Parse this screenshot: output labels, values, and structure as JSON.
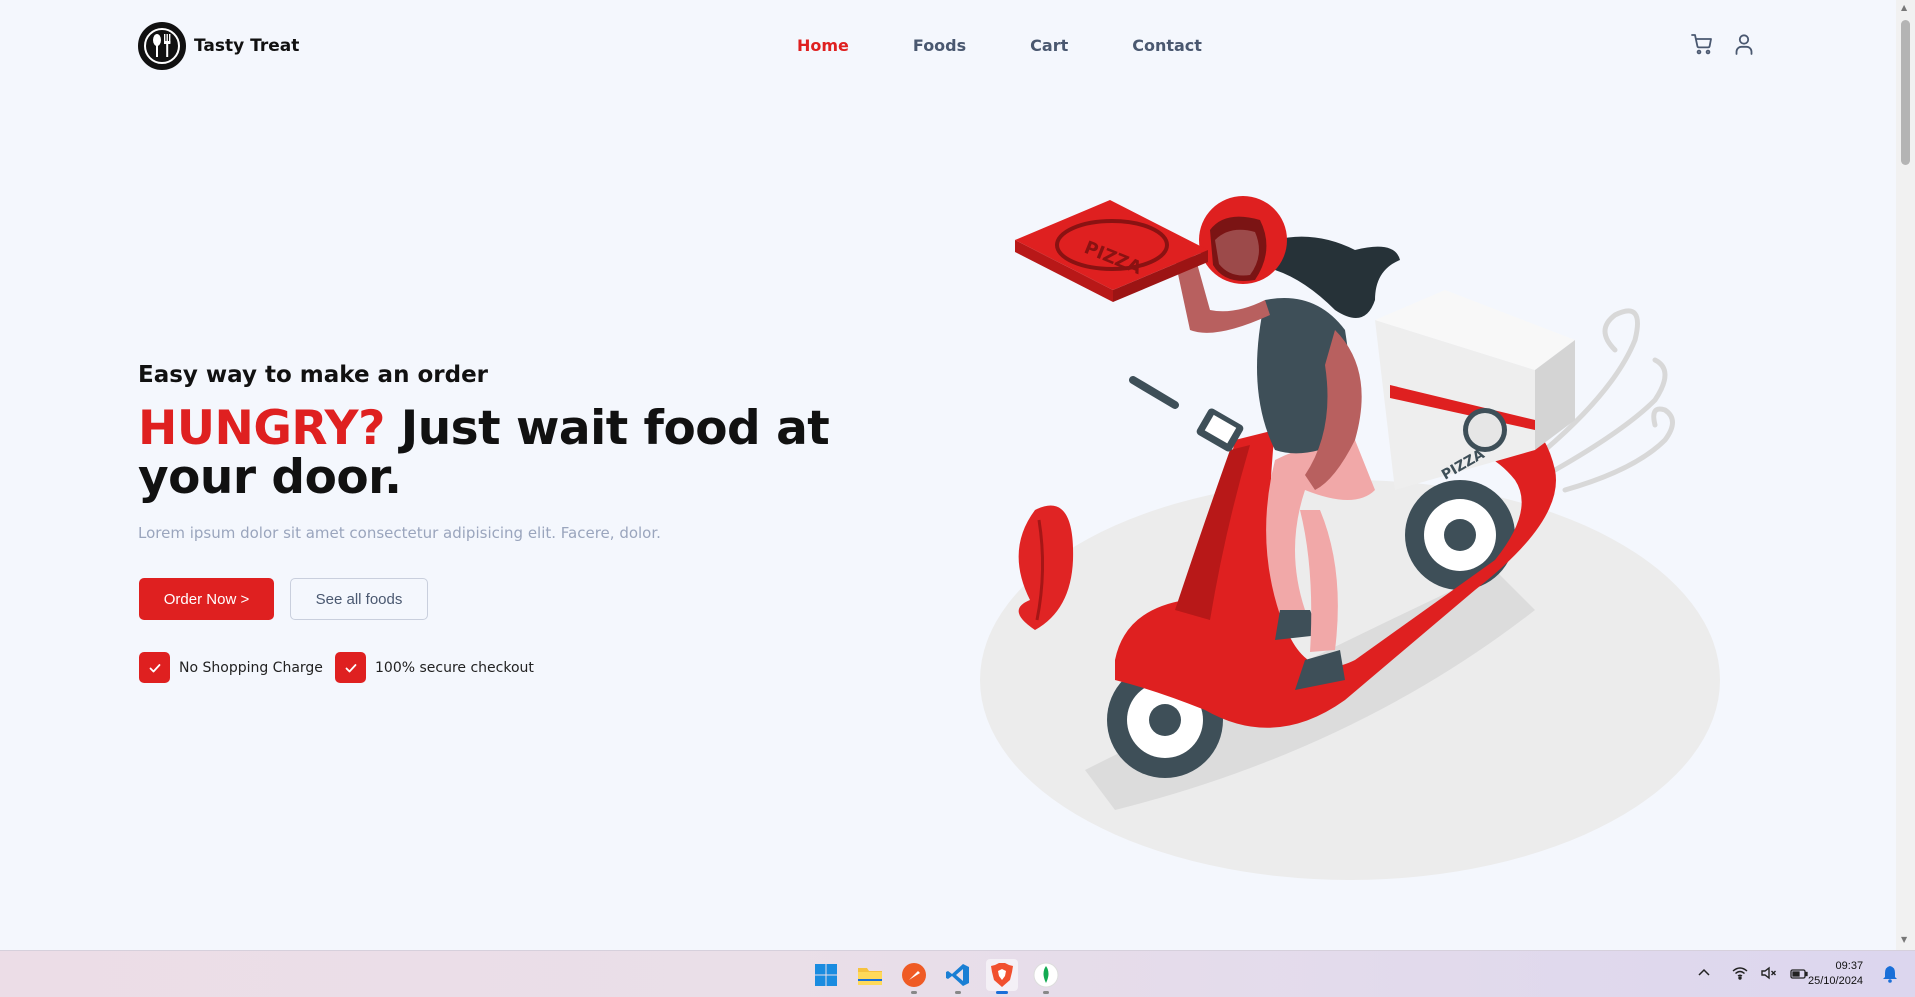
{
  "brand": {
    "name": "Tasty Treat"
  },
  "nav": {
    "items": [
      {
        "label": "Home",
        "active": true
      },
      {
        "label": "Foods",
        "active": false
      },
      {
        "label": "Cart",
        "active": false
      },
      {
        "label": "Contact",
        "active": false
      }
    ]
  },
  "header_icons": [
    "cart-icon",
    "user-icon"
  ],
  "hero": {
    "subtitle": "Easy way to make an order",
    "title_accent": "HUNGRY?",
    "title_rest": " Just wait food at your door.",
    "description": "Lorem ipsum dolor sit amet consectetur adipisicing elit. Facere, dolor.",
    "primary_button": "Order Now >",
    "secondary_button": "See all foods",
    "features": [
      "No Shopping Charge",
      "100% secure checkout"
    ]
  },
  "illustration": {
    "box_text": "PIZZA"
  },
  "colors": {
    "accent": "#df2020",
    "nav_text": "#4a5870",
    "muted": "#9aa5bd",
    "background": "#f4f7fd"
  },
  "taskbar": {
    "apps": [
      "windows-start-icon",
      "file-explorer-icon",
      "postman-icon",
      "vscode-icon",
      "brave-browser-icon",
      "mongodb-compass-icon"
    ],
    "time": "09:37",
    "date": "25/10/2024"
  }
}
